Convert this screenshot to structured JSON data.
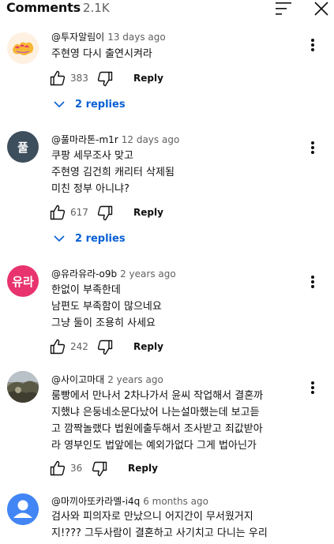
{
  "header": {
    "title": "Comments",
    "count": "2.1K"
  },
  "comments": [
    {
      "author": "@투자알림이",
      "time": "13 days ago",
      "text": "주현영 다시 출연시켜라",
      "likes": "383",
      "reply_label": "Reply",
      "replies_label": "2 replies"
    },
    {
      "author": "@풀마라톤-m1r",
      "time": "12 days ago",
      "avatar_text": "풀",
      "text": "쿠팡 세무조사 맞고\n주현영 김건희 캐리터 삭제됨\n미친 정부 아니냐?",
      "likes": "617",
      "reply_label": "Reply",
      "replies_label": "2 replies"
    },
    {
      "author": "@유라유라-o9b",
      "time": "2 years ago",
      "avatar_text": "유라",
      "text": "한없이 부족한데\n남편도 부족함이 많으네요\n그냥 둘이 조용히 사세요",
      "likes": "242",
      "reply_label": "Reply"
    },
    {
      "author": "@사이고마대",
      "time": "2 years ago",
      "text": "룸빵에서 만나서 2차나가서 윤씨 작업해서 결혼까\n지했냐 은둥네소문다났어 나는설마했는데 보고듣\n고 깜짝놀랬다 법원에출두해서 조사받고 죄값받아\n라 영부인도 법앞에는 예외가없다 그게 법아닌가",
      "likes": "36",
      "reply_label": "Reply"
    },
    {
      "author": "@마끼아또카라멜-i4q",
      "time": "6 months ago",
      "text": "검사와 피의자로 만났으니 어지간이 무서웠거지\n지!??? 그두사람이 결혼하고 사기치고 다니는 우리"
    }
  ],
  "colors": {
    "link_blue": "#065fd4",
    "secondary_text": "#606060",
    "avatar_poolmarathon": "#3d4e5c",
    "avatar_yura": "#e8336e",
    "avatar_default": "#4285f4"
  },
  "icons": [
    "sort-icon",
    "close-icon",
    "like-icon",
    "dislike-icon",
    "chevron-down-icon",
    "more-options-icon"
  ]
}
